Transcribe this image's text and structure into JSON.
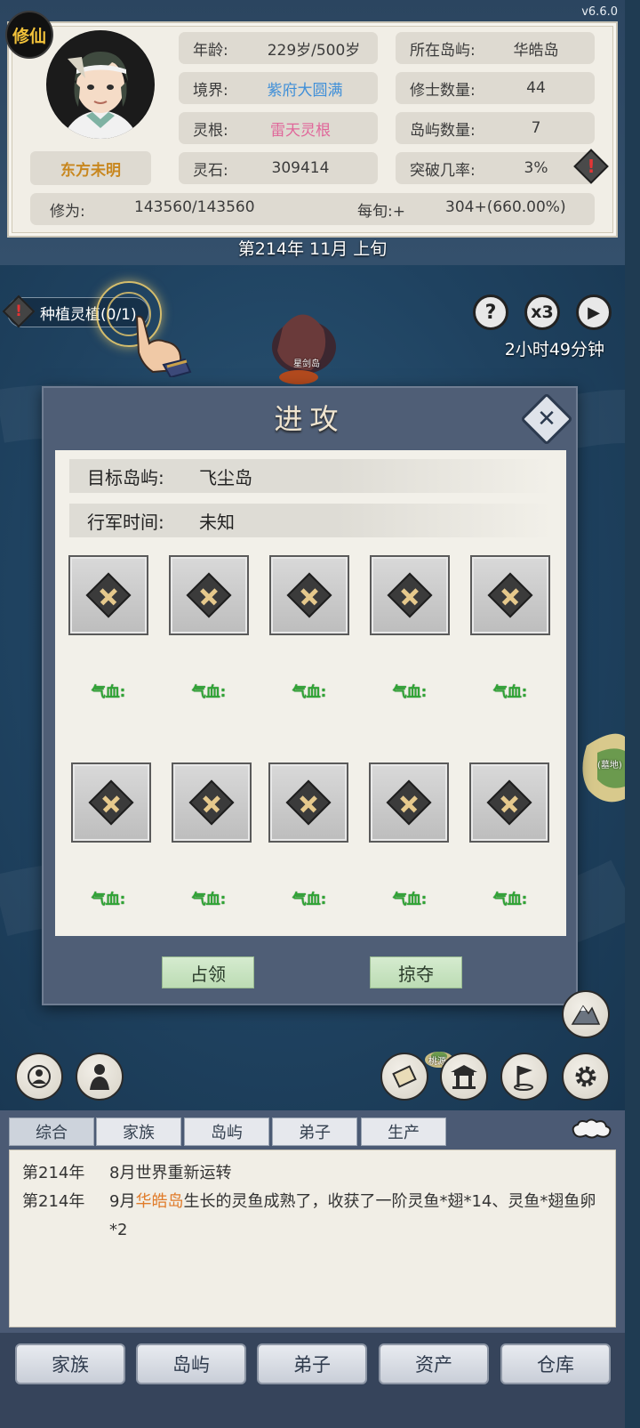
{
  "app": {
    "version": "v6.6.0",
    "badge": "修仙"
  },
  "player": {
    "name": "东方未明",
    "age_label": "年龄:",
    "age_value": "229岁/500岁",
    "realm_label": "境界:",
    "realm_value": "紫府大圆满",
    "root_label": "灵根:",
    "root_value": "雷天灵根",
    "stone_label": "灵石:",
    "stone_value": "309414",
    "island_label": "所在岛屿:",
    "island_value": "华皓岛",
    "cultivators_label": "修士数量:",
    "cultivators_value": "44",
    "islands_label": "岛屿数量:",
    "islands_value": "7",
    "breakthrough_label": "突破几率:",
    "breakthrough_value": "3%",
    "cultivation_label": "修为:",
    "cultivation_value": "143560/143560",
    "per_period_label": "每旬:+",
    "per_period_value": "304+(660.00%)",
    "warning_glyph": "!"
  },
  "date": "第214年 11月 上旬",
  "map": {
    "task_label": "种植灵植(0/1)",
    "help_glyph": "?",
    "speed_label": "x3",
    "play_glyph": "▶",
    "timer": "2小时49分钟",
    "island_names": [
      "星剑岛",
      "(墓地)",
      "桃源"
    ]
  },
  "dialog": {
    "title": "进攻",
    "close_glyph": "✕",
    "target_label": "目标岛屿:",
    "target_value": "飞尘岛",
    "march_label": "行军时间:",
    "march_value": "未知",
    "hp_label": "气血:",
    "slot_rows": 2,
    "slots_per_row": 5,
    "occupy_button": "占领",
    "plunder_button": "掠夺"
  },
  "log": {
    "tabs": [
      "综合",
      "家族",
      "岛屿",
      "弟子",
      "生产"
    ],
    "entries": [
      {
        "year": "第214年",
        "text": "8月世界重新运转"
      },
      {
        "year": "第214年",
        "prefix": "9月",
        "highlight": "华皓岛",
        "text": "生长的灵鱼成熟了，收获了一阶灵鱼*翅*14、灵鱼*翅鱼卵*2"
      }
    ]
  },
  "bottom_nav": [
    "家族",
    "岛屿",
    "弟子",
    "资产",
    "仓库"
  ],
  "colors": {
    "accent_blue": "#3f8fd8",
    "accent_pink": "#e0679a",
    "name_gold": "#c8871f",
    "hp_green": "#2fa534",
    "highlight_orange": "#e07b2a"
  }
}
